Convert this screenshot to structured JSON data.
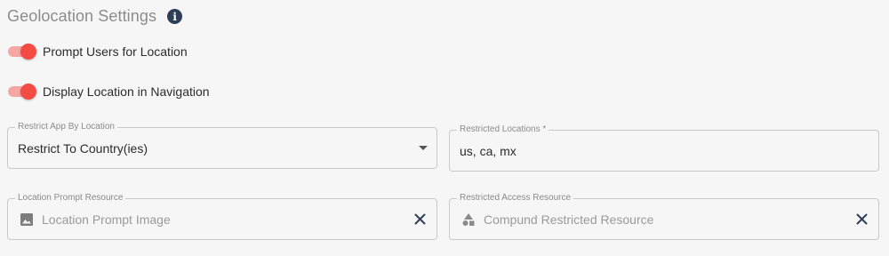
{
  "section": {
    "title": "Geolocation Settings",
    "info_icon": "info-icon",
    "info_glyph": "i"
  },
  "toggles": {
    "prompt_users": {
      "label": "Prompt Users for Location",
      "on": true
    },
    "display_location": {
      "label": "Display Location in Navigation",
      "on": true
    }
  },
  "fields": {
    "restrict_app": {
      "label": "Restrict App By Location",
      "value": "Restrict To Country(ies)"
    },
    "restricted_locations": {
      "label": "Restricted Locations *",
      "value": "us, ca, mx"
    },
    "location_prompt_resource": {
      "label": "Location Prompt Resource",
      "placeholder": "Location Prompt Image",
      "icon": "image-icon"
    },
    "restricted_access_resource": {
      "label": "Restricted Access Resource",
      "placeholder": "Compund Restricted Resource",
      "icon": "shapes-icon"
    }
  },
  "colors": {
    "toggle_thumb": "#f44b44",
    "toggle_track": "#f7a7a3",
    "info_icon_bg": "#2f3e56",
    "clear_icon": "#2f3e56"
  }
}
